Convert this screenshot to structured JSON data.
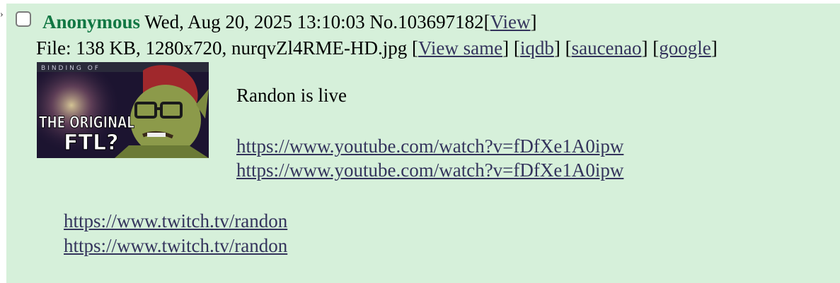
{
  "post": {
    "name": "Anonymous",
    "datetime": "Wed, Aug 20, 2025 13:10:03",
    "number": "No.103697182",
    "view_bracket_open": "[",
    "view_label": "View",
    "view_bracket_close": "]",
    "file_prefix": "File: 138 KB, 1280x720, nurqvZl4RME-HD.jpg",
    "file_links": [
      {
        "label": "View same"
      },
      {
        "label": "iqdb"
      },
      {
        "label": "saucenao"
      },
      {
        "label": "google"
      }
    ],
    "thumbnail": {
      "text_line1": "THE ORIGINAL",
      "text_line2": "FTL?"
    },
    "message": {
      "text": "Randon is live",
      "youtube_links": [
        "https://www.youtube.com/watch?v=fDfXe1A0ipw",
        "https://www.youtube.com/watch?v=fDfXe1A0ipw"
      ],
      "twitch_links": [
        "https://www.twitch.tv/randon",
        "https://www.twitch.tv/randon"
      ]
    }
  },
  "colors": {
    "post_bg": "#d6f0da",
    "name": "#117743",
    "link": "#34345c"
  }
}
